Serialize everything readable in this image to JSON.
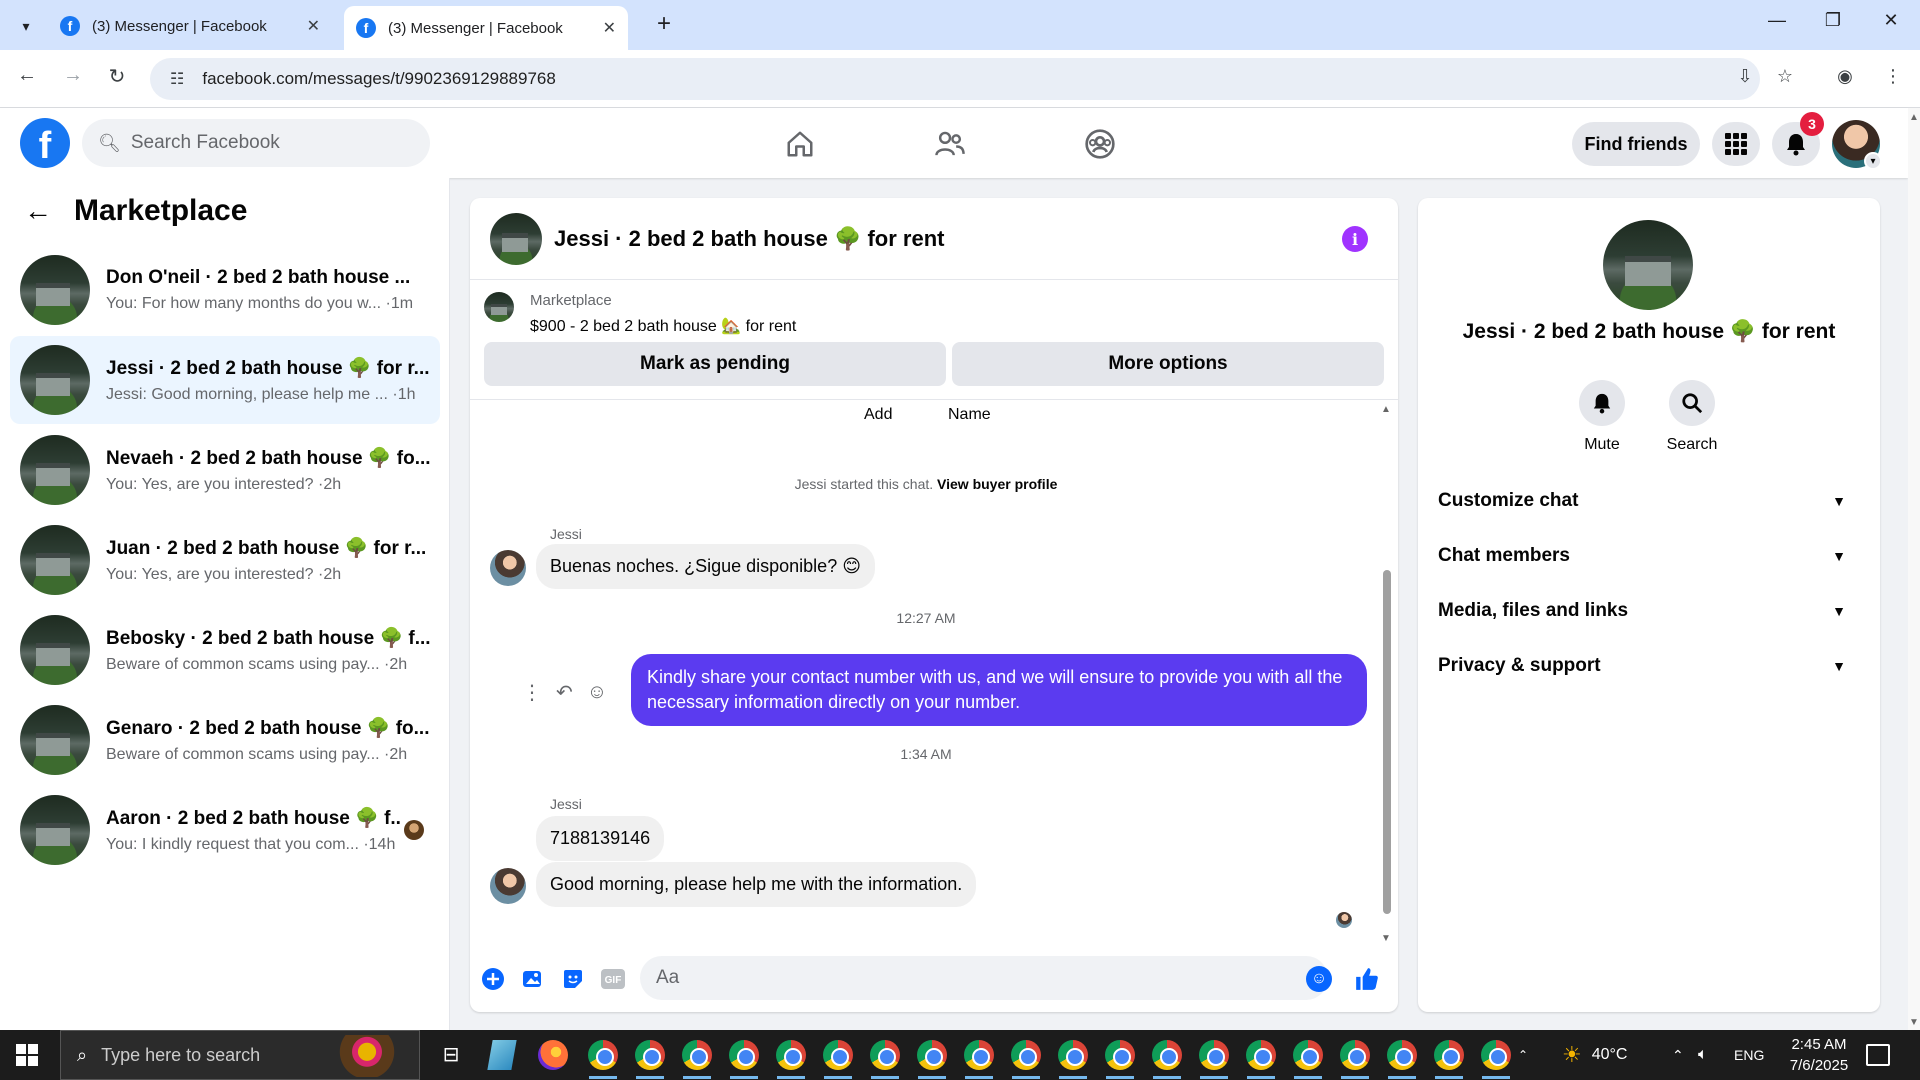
{
  "browser": {
    "tabs": [
      {
        "title": "(3) Messenger | Facebook",
        "active": false
      },
      {
        "title": "(3) Messenger | Facebook",
        "active": true
      }
    ],
    "url": "facebook.com/messages/t/9902369129889768"
  },
  "fb_nav": {
    "logo": "f",
    "search_placeholder": "Search Facebook",
    "find_friends": "Find friends",
    "notification_count": "3"
  },
  "sidebar": {
    "title": "Marketplace",
    "conversations": [
      {
        "name": "Don O'neil · 2 bed 2 bath house ...",
        "preview": "You: For how many months do you w... ·1m",
        "active": false
      },
      {
        "name": "Jessi · 2 bed 2 bath house 🌳 for r...",
        "preview": "Jessi: Good morning, please help me ... ·1h",
        "active": true
      },
      {
        "name": "Nevaeh · 2 bed 2 bath house 🌳 fo...",
        "preview": "You: Yes, are you interested? ·2h",
        "active": false
      },
      {
        "name": "Juan · 2 bed 2 bath house 🌳 for r...",
        "preview": "You: Yes, are you interested? ·2h",
        "active": false
      },
      {
        "name": "Bebosky · 2 bed 2 bath house 🌳 f...",
        "preview": "Beware of common scams using pay... ·2h",
        "active": false
      },
      {
        "name": "Genaro · 2 bed 2 bath house 🌳 fo...",
        "preview": "Beware of common scams using pay... ·2h",
        "active": false
      },
      {
        "name": "Aaron · 2 bed 2 bath house 🌳 f...",
        "preview": "You: I kindly request that you com... ·14h",
        "active": false
      }
    ]
  },
  "chat": {
    "title": "Jessi · 2 bed 2 bath house 🌳 for rent",
    "listing_label": "Marketplace",
    "listing_price": "$900 - 2 bed 2 bath house 🏡 for rent",
    "mark_pending": "Mark as pending",
    "more_options": "More options",
    "tab_add": "Add",
    "tab_name": "Name",
    "system_text": "Jessi started this chat.",
    "system_link": "View buyer profile",
    "messages": [
      {
        "sender": "Jessi",
        "text": "Buenas noches. ¿Sigue disponible? 😊"
      },
      {
        "timestamp": "12:27 AM"
      },
      {
        "text": "Kindly share your contact number with us, and we will ensure to provide you with all the necessary information directly on your number."
      },
      {
        "timestamp": "1:34 AM"
      },
      {
        "sender": "Jessi",
        "text": "7188139146"
      },
      {
        "text": "Good morning, please help me with the information."
      }
    ],
    "composer_placeholder": "Aa"
  },
  "right_panel": {
    "name": "Jessi · 2 bed 2 bath house 🌳 for rent",
    "mute": "Mute",
    "search": "Search",
    "sections": [
      "Customize chat",
      "Chat members",
      "Media, files and links",
      "Privacy & support"
    ]
  },
  "taskbar": {
    "search_placeholder": "Type here to search",
    "temperature": "40°C",
    "language": "ENG",
    "time": "2:45 AM",
    "date": "7/6/2025"
  },
  "icons": {
    "colors": {
      "facebook_blue": "#1877f2",
      "messenger_accent": "#5b3bf0",
      "info_purple": "#a033ff",
      "badge_red": "#e41e3f"
    }
  }
}
